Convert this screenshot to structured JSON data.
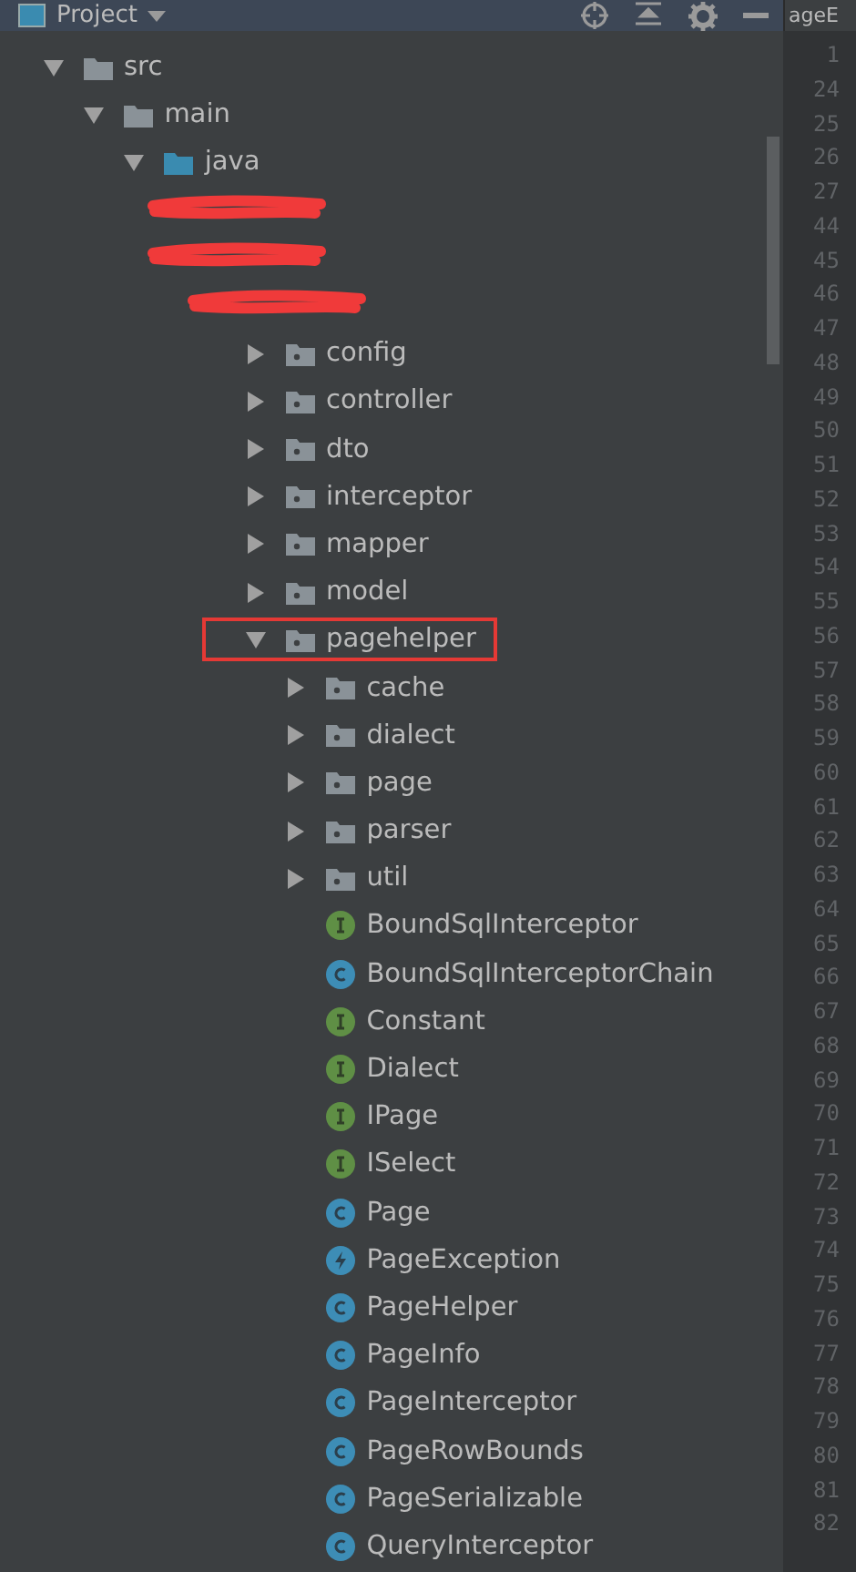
{
  "header": {
    "title": "Project"
  },
  "editor_tab": {
    "label": "ageE"
  },
  "line_numbers": [
    "1",
    "24",
    "25",
    "26",
    "27",
    "44",
    "45",
    "46",
    "47",
    "48",
    "49",
    "50",
    "51",
    "52",
    "53",
    "54",
    "55",
    "56",
    "57",
    "58",
    "59",
    "60",
    "61",
    "62",
    "63",
    "64",
    "65",
    "66",
    "67",
    "68",
    "69",
    "70",
    "71",
    "72",
    "73",
    "74",
    "75",
    "76",
    "77",
    "78",
    "79",
    "80",
    "81",
    "82"
  ],
  "tree": [
    {
      "name": "src",
      "kind": "folder",
      "expanded": true,
      "highlighted": false,
      "children": [
        {
          "name": "main",
          "kind": "folder",
          "expanded": true,
          "highlighted": false,
          "children": [
            {
              "name": "java",
              "kind": "source-folder",
              "expanded": true,
              "highlighted": false,
              "children": [
                {
                  "kind": "redacted",
                  "highlighted": false
                },
                {
                  "kind": "redacted",
                  "highlighted": false,
                  "children": [
                    {
                      "kind": "redacted",
                      "highlighted": false,
                      "children": [
                        {
                          "name": "config",
                          "kind": "package",
                          "expanded": false,
                          "highlighted": false
                        },
                        {
                          "name": "controller",
                          "kind": "package",
                          "expanded": false,
                          "highlighted": false
                        },
                        {
                          "name": "dto",
                          "kind": "package",
                          "expanded": false,
                          "highlighted": false
                        },
                        {
                          "name": "interceptor",
                          "kind": "package",
                          "expanded": false,
                          "highlighted": false
                        },
                        {
                          "name": "mapper",
                          "kind": "package",
                          "expanded": false,
                          "highlighted": false
                        },
                        {
                          "name": "model",
                          "kind": "package",
                          "expanded": false,
                          "highlighted": false
                        },
                        {
                          "name": "pagehelper",
                          "kind": "package",
                          "expanded": true,
                          "highlighted": true,
                          "children": [
                            {
                              "name": "cache",
                              "kind": "package",
                              "expanded": false,
                              "highlighted": false
                            },
                            {
                              "name": "dialect",
                              "kind": "package",
                              "expanded": false,
                              "highlighted": false
                            },
                            {
                              "name": "page",
                              "kind": "package",
                              "expanded": false,
                              "highlighted": false
                            },
                            {
                              "name": "parser",
                              "kind": "package",
                              "expanded": false,
                              "highlighted": false
                            },
                            {
                              "name": "util",
                              "kind": "package",
                              "expanded": false,
                              "highlighted": false
                            },
                            {
                              "name": "BoundSqlInterceptor",
                              "kind": "interface",
                              "highlighted": false
                            },
                            {
                              "name": "BoundSqlInterceptorChain",
                              "kind": "class",
                              "highlighted": false
                            },
                            {
                              "name": "Constant",
                              "kind": "interface",
                              "highlighted": false
                            },
                            {
                              "name": "Dialect",
                              "kind": "interface",
                              "highlighted": false
                            },
                            {
                              "name": "IPage",
                              "kind": "interface",
                              "highlighted": false
                            },
                            {
                              "name": "ISelect",
                              "kind": "interface",
                              "highlighted": false
                            },
                            {
                              "name": "Page",
                              "kind": "class",
                              "highlighted": false
                            },
                            {
                              "name": "PageException",
                              "kind": "exception",
                              "highlighted": false
                            },
                            {
                              "name": "PageHelper",
                              "kind": "class",
                              "highlighted": false
                            },
                            {
                              "name": "PageInfo",
                              "kind": "class",
                              "highlighted": false
                            },
                            {
                              "name": "PageInterceptor",
                              "kind": "class",
                              "highlighted": false
                            },
                            {
                              "name": "PageRowBounds",
                              "kind": "class",
                              "highlighted": false
                            },
                            {
                              "name": "PageSerializable",
                              "kind": "class",
                              "highlighted": false
                            },
                            {
                              "name": "QueryInterceptor",
                              "kind": "class",
                              "highlighted": false
                            }
                          ]
                        }
                      ]
                    }
                  ]
                }
              ]
            }
          ]
        }
      ]
    }
  ]
}
